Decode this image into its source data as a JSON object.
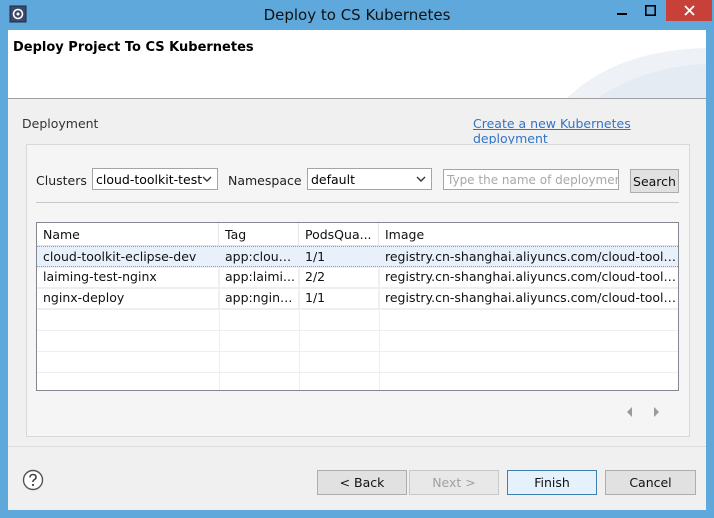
{
  "window": {
    "title": "Deploy to CS Kubernetes"
  },
  "header": {
    "title": "Deploy Project To CS Kubernetes"
  },
  "deployment": {
    "label": "Deployment",
    "create_link": "Create a new Kubernetes deployment"
  },
  "filters": {
    "clusters_label": "Clusters",
    "clusters_value": "cloud-toolkit-test",
    "namespace_label": "Namespace",
    "namespace_value": "default",
    "search_placeholder": "Type the name of deploymer",
    "search_button": "Search"
  },
  "table": {
    "columns": [
      "Name",
      "Tag",
      "PodsQua...",
      "Image"
    ],
    "rows": [
      [
        "cloud-toolkit-eclipse-dev",
        "app:cloud...",
        "1/1",
        "registry.cn-shanghai.aliyuncs.com/cloud-toolkit/..."
      ],
      [
        "laiming-test-nginx",
        "app:laimi...",
        "2/2",
        "registry.cn-shanghai.aliyuncs.com/cloud-toolkit/..."
      ],
      [
        "nginx-deploy",
        "app:nginx...",
        "1/1",
        "registry.cn-shanghai.aliyuncs.com/cloud-toolkit/..."
      ]
    ]
  },
  "buttons": {
    "back": "< Back",
    "next": "Next >",
    "finish": "Finish",
    "cancel": "Cancel"
  },
  "colors": {
    "titlebar": "#5fa8dc",
    "link": "#3273c8",
    "close_button": "#c7403a",
    "selected_row": "#e8f1fb"
  }
}
